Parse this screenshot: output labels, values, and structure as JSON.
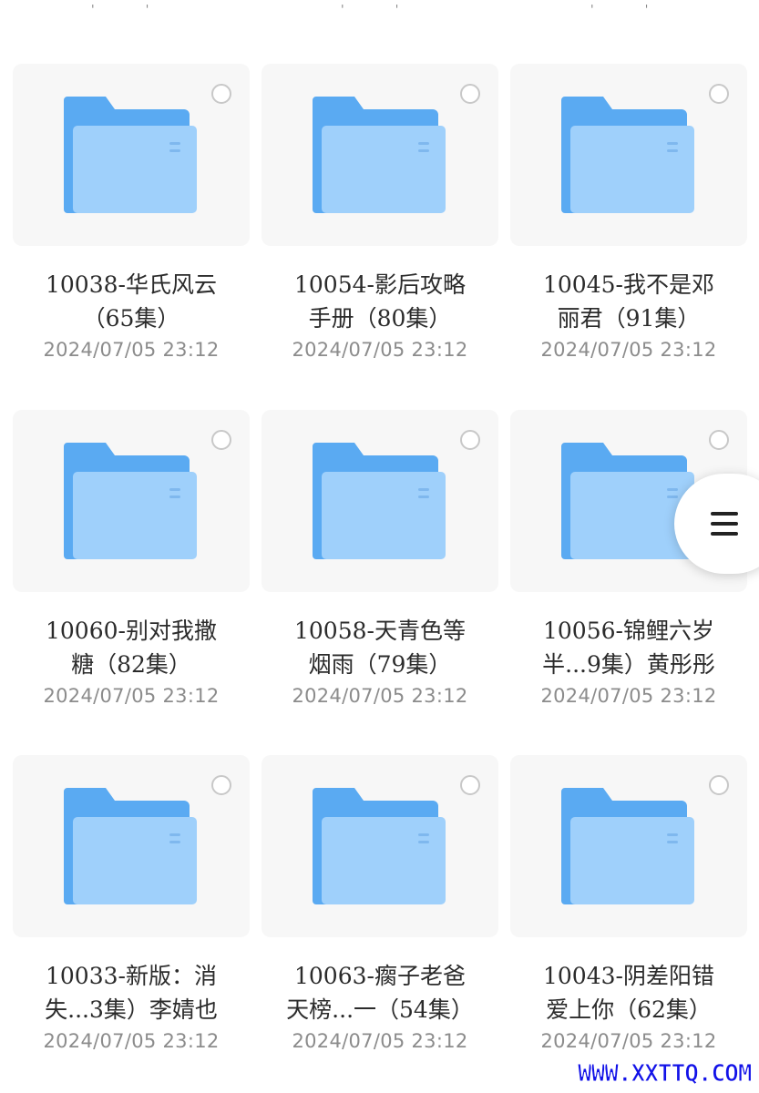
{
  "colors": {
    "folder_back": "#5aaaf2",
    "folder_front": "#9fd0fb",
    "card_bg": "#f7f7f7",
    "text": "#2b2b2b",
    "date": "#8c8c8c",
    "watermark": "#1212e8"
  },
  "top_partial_text": [
    "' '",
    "' '",
    "' '"
  ],
  "folders": [
    {
      "name_line1": "10038-华氏风云",
      "name_line2": "（65集）",
      "date": "2024/07/05 23:12"
    },
    {
      "name_line1": "10054-影后攻略",
      "name_line2": "手册（80集）",
      "date": "2024/07/05 23:12"
    },
    {
      "name_line1": "10045-我不是邓",
      "name_line2": "丽君（91集）",
      "date": "2024/07/05 23:12"
    },
    {
      "name_line1": "10060-别对我撒",
      "name_line2": "糖（82集）",
      "date": "2024/07/05 23:12"
    },
    {
      "name_line1": "10058-天青色等",
      "name_line2": "烟雨（79集）",
      "date": "2024/07/05 23:12"
    },
    {
      "name_line1": "10056-锦鲤六岁",
      "name_line2": "半...9集）黄彤彤",
      "date": "2024/07/05 23:12"
    },
    {
      "name_line1": "10033-新版：消",
      "name_line2": "失...3集）李婧也",
      "date": "2024/07/05 23:12"
    },
    {
      "name_line1": "10063-瘸子老爸",
      "name_line2": "天榜...一（54集）",
      "date": "2024/07/05 23:12"
    },
    {
      "name_line1": "10043-阴差阳错",
      "name_line2": "爱上你（62集）",
      "date": "2024/07/05 23:12"
    }
  ],
  "float_menu_icon": "hamburger-icon",
  "watermark": "WWW.XXTTQ.COM"
}
